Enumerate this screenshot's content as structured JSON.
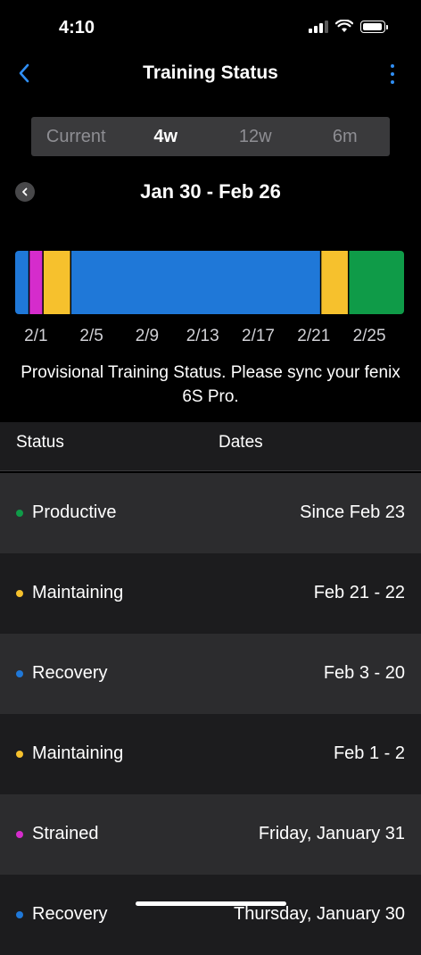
{
  "status_bar": {
    "time": "4:10"
  },
  "nav": {
    "title": "Training Status"
  },
  "segments": [
    {
      "label": "Current",
      "active": false
    },
    {
      "label": "4w",
      "active": true
    },
    {
      "label": "12w",
      "active": false
    },
    {
      "label": "6m",
      "active": false
    }
  ],
  "range": {
    "label": "Jan 30 - Feb 26"
  },
  "colors": {
    "productive": "#0f9b48",
    "maintaining": "#f6c12d",
    "recovery": "#1f78d8",
    "strained": "#d52ccc"
  },
  "timeline": {
    "days": 28,
    "segments": [
      {
        "status": "recovery",
        "days": 1
      },
      {
        "status": "strained",
        "days": 1
      },
      {
        "status": "maintaining",
        "days": 2
      },
      {
        "status": "recovery",
        "days": 18
      },
      {
        "status": "maintaining",
        "days": 2
      },
      {
        "status": "productive",
        "days": 4
      }
    ],
    "ticks": [
      {
        "label": "2/1",
        "day": 2
      },
      {
        "label": "2/5",
        "day": 6
      },
      {
        "label": "2/9",
        "day": 10
      },
      {
        "label": "2/13",
        "day": 14
      },
      {
        "label": "2/17",
        "day": 18
      },
      {
        "label": "2/21",
        "day": 22
      },
      {
        "label": "2/25",
        "day": 26
      }
    ]
  },
  "notice": "Provisional Training Status. Please sync your fenix 6S Pro.",
  "table": {
    "headers": {
      "status": "Status",
      "dates": "Dates"
    },
    "rows": [
      {
        "status": "Productive",
        "color": "#0f9b48",
        "dates": "Since Feb 23"
      },
      {
        "status": "Maintaining",
        "color": "#f6c12d",
        "dates": "Feb 21 - 22"
      },
      {
        "status": "Recovery",
        "color": "#1f78d8",
        "dates": "Feb 3 - 20"
      },
      {
        "status": "Maintaining",
        "color": "#f6c12d",
        "dates": "Feb 1 - 2"
      },
      {
        "status": "Strained",
        "color": "#d52ccc",
        "dates": "Friday, January 31"
      },
      {
        "status": "Recovery",
        "color": "#1f78d8",
        "dates": "Thursday, January 30"
      }
    ]
  }
}
